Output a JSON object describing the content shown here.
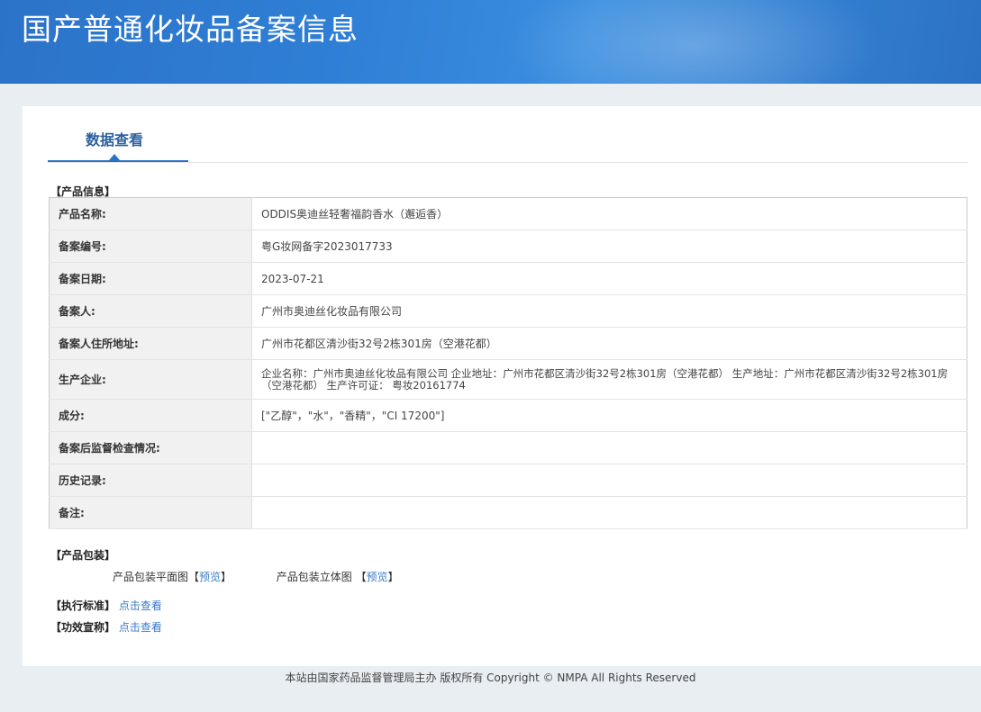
{
  "header": {
    "title": "国产普通化妆品备案信息"
  },
  "tab": {
    "label": "数据查看"
  },
  "product_section": {
    "title": "【产品信息】"
  },
  "rows": [
    {
      "label": "产品名称:",
      "value": "ODDIS奥迪丝轻奢福韵香水（邂逅香）"
    },
    {
      "label": "备案编号:",
      "value": "粤G妆网备字2023017733"
    },
    {
      "label": "备案日期:",
      "value": "2023-07-21"
    },
    {
      "label": "备案人:",
      "value": "广州市奥迪丝化妆品有限公司"
    },
    {
      "label": "备案人住所地址:",
      "value": "广州市花都区清沙街32号2栋301房（空港花都）"
    },
    {
      "label": "生产企业:",
      "value": "企业名称：广州市奥迪丝化妆品有限公司 企业地址：广州市花都区清沙街32号2栋301房（空港花都） 生产地址：广州市花都区清沙街32号2栋301房（空港花都） 生产许可证： 粤妆20161774"
    },
    {
      "label": "成分:",
      "value": "[\"乙醇\"，\"水\"，\"香精\"，\"CI 17200\"]"
    },
    {
      "label": "备案后监督检查情况:",
      "value": ""
    },
    {
      "label": "历史记录:",
      "value": ""
    },
    {
      "label": "备注:",
      "value": ""
    }
  ],
  "packaging": {
    "title": "【产品包装】",
    "flat_label": "产品包装平面图",
    "flat_link": "预览",
    "solid_label": "产品包装立体图",
    "solid_link": "预览",
    "bracket_open": "【",
    "bracket_close": "】"
  },
  "standard": {
    "title": "【执行标准】",
    "link": "点击查看"
  },
  "efficacy": {
    "title": "【功效宣称】",
    "link": "点击查看"
  },
  "footer": {
    "text": "本站由国家药品监督管理局主办 版权所有 Copyright © NMPA All Rights Reserved"
  }
}
